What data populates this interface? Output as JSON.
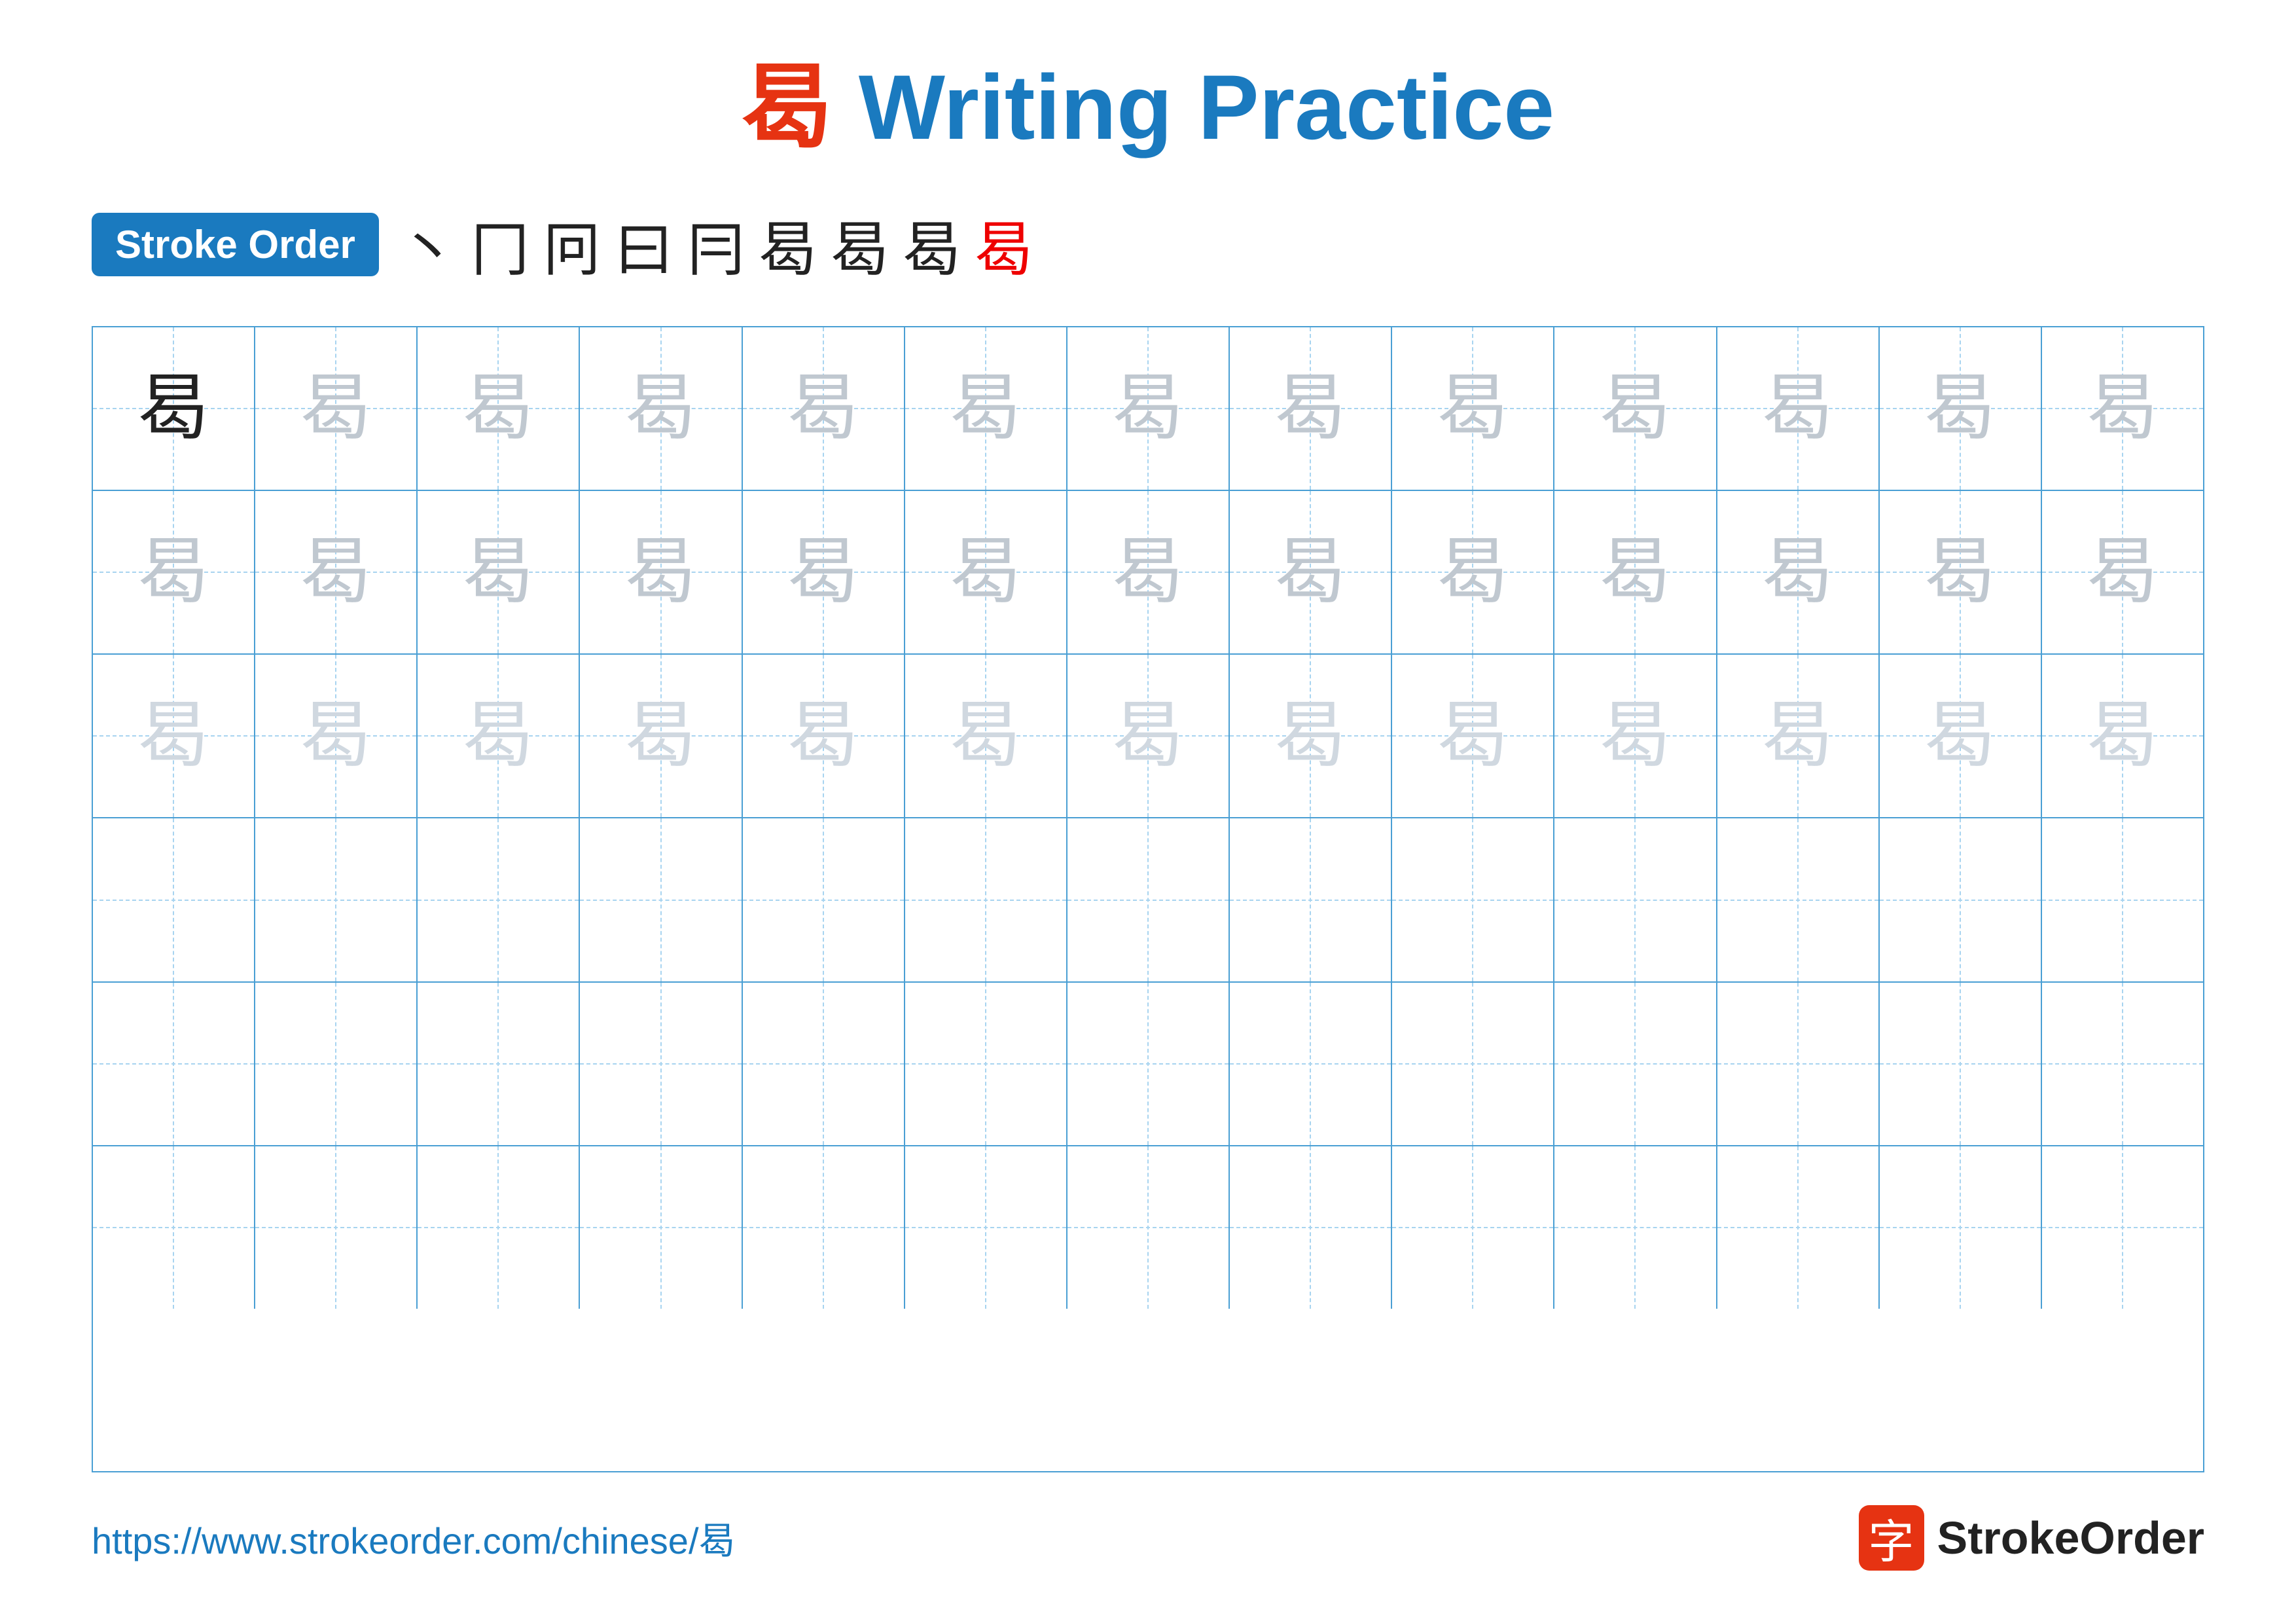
{
  "title": {
    "char": "曷",
    "label": " Writing Practice",
    "full": "曷 Writing Practice"
  },
  "stroke_order": {
    "badge_label": "Stroke Order",
    "strokes": [
      "丶",
      "冂",
      "冋",
      "曰",
      "冃",
      "曷",
      "曷",
      "曷",
      "曷"
    ]
  },
  "grid": {
    "rows": 6,
    "cols": 13,
    "char": "曷",
    "row_styles": [
      "dark",
      "light1",
      "light2",
      "empty",
      "empty",
      "empty"
    ]
  },
  "footer": {
    "url": "https://www.strokeorder.com/chinese/曷",
    "logo_char": "字",
    "logo_text": "StrokeOrder"
  }
}
